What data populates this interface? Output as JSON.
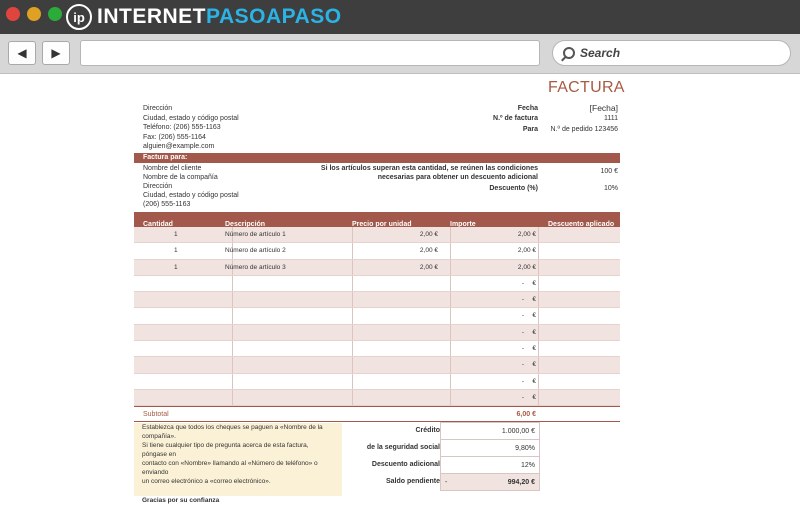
{
  "browser": {
    "brand_left": "INTERNET",
    "brand_right": "PASOAPASO",
    "logo_mark": "ip",
    "search_placeholder": "Search",
    "icons": [
      "back-arrow-icon",
      "forward-arrow-icon",
      "search-icon"
    ]
  },
  "invoice": {
    "title": "FACTURA",
    "seller": {
      "address": "Dirección",
      "city": "Ciudad, estado y código postal",
      "phone": "Teléfono: (206) 555-1163",
      "fax": "Fax: (206) 555-1164",
      "email": "alguien@example.com"
    },
    "meta": {
      "date_label": "Fecha",
      "date_value": "[Fecha]",
      "number_label": "N.º de factura",
      "number_value": "1111",
      "for_label": "Para",
      "for_value": "N.º de pedido 123456"
    },
    "bill_to": {
      "header": "Factura para:",
      "client": "Nombre del cliente",
      "company": "Nombre de la compañía",
      "address": "Dirección",
      "city": "Ciudad, estado y código postal",
      "phone": "(206) 555-1163",
      "condition_line1": "Si los artículos superan esta cantidad, se reúnen las condiciones",
      "condition_line2": "necesarias para obtener un descuento adicional",
      "condition_value": "100 €",
      "discount_label": "Descuento (%)",
      "discount_value": "10%"
    },
    "table": {
      "headers": [
        "Cantidad",
        "Descripción",
        "Precio por unidad",
        "Importe",
        "Descuento aplicado"
      ],
      "rows": [
        [
          "1",
          "Número de artículo 1",
          "2,00 €",
          "2,00 €",
          ""
        ],
        [
          "1",
          "Número de artículo 2",
          "2,00 €",
          "2,00 €",
          ""
        ],
        [
          "1",
          "Número de artículo 3",
          "2,00 €",
          "2,00 €",
          ""
        ],
        [
          "",
          "",
          "",
          "-",
          "€"
        ],
        [
          "",
          "",
          "",
          "-",
          "€"
        ],
        [
          "",
          "",
          "",
          "-",
          "€"
        ],
        [
          "",
          "",
          "",
          "-",
          "€"
        ],
        [
          "",
          "",
          "",
          "-",
          "€"
        ],
        [
          "",
          "",
          "",
          "-",
          "€"
        ],
        [
          "",
          "",
          "",
          "-",
          "€"
        ],
        [
          "",
          "",
          "",
          "-",
          "€"
        ]
      ],
      "subtotal_label": "Subtotal",
      "subtotal_value": "6,00 €"
    },
    "note": {
      "line1": "Establezca que todos los cheques se paguen a «Nombre de la",
      "line2": "compañía».",
      "line3": "Si tiene cualquier tipo de pregunta acerca de esta factura, póngase en",
      "line4": "contacto con «Nombre» llamando al «Número de teléfono» o enviando",
      "line5": "un correo electrónico a «correo electrónico».",
      "thanks": "Gracias por su confianza"
    },
    "summary": [
      {
        "label": "Crédito",
        "value": "1.000,00 €"
      },
      {
        "label": "de la seguridad social",
        "value": "9,80%"
      },
      {
        "label": "Descuento adicional",
        "value": "12%"
      },
      {
        "label": "Saldo pendiente",
        "prefix": "-",
        "value": "994,20 €"
      }
    ],
    "colors": {
      "accent": "#a2584a",
      "title": "#a85a43",
      "note_bg": "#fbf1d6",
      "row_shade": "#f1e3e0"
    }
  }
}
